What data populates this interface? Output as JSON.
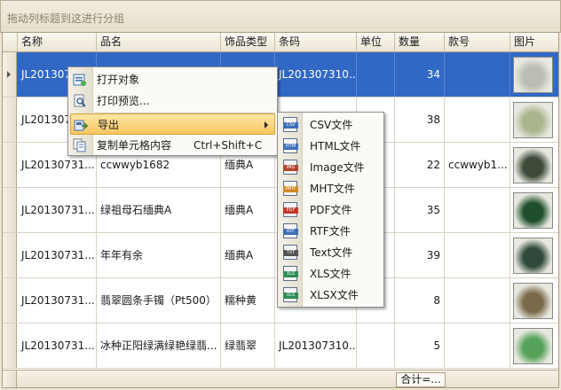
{
  "group_panel": {
    "hint": "拖动列标题到这进行分组"
  },
  "columns": [
    "名称",
    "品名",
    "饰品类型",
    "条码",
    "单位",
    "数量",
    "款号",
    "图片"
  ],
  "rows": [
    {
      "name": "JL201307",
      "product": "",
      "type": "",
      "barcode": "JL201307310...",
      "unit": "",
      "qty": "34",
      "style_no": "",
      "thumb": "#b9bdb3",
      "selected": true
    },
    {
      "name": "JL201307",
      "product": "",
      "type": "",
      "barcode": "",
      "unit": "",
      "qty": "38",
      "style_no": "",
      "thumb": "#a9b58c",
      "selected": false
    },
    {
      "name": "JL20130731...",
      "product": "ccwwyb1682",
      "type": "缅典A",
      "barcode": "",
      "unit": "",
      "qty": "22",
      "style_no": "ccwwyb1...",
      "thumb": "#3d4a3a",
      "selected": false
    },
    {
      "name": "JL20130731...",
      "product": "绿祖母石缅典A",
      "type": "缅典A",
      "barcode": "",
      "unit": "",
      "qty": "35",
      "style_no": "",
      "thumb": "#1f4f2c",
      "selected": false
    },
    {
      "name": "JL20130731...",
      "product": "年年有余",
      "type": "缅典A",
      "barcode": "",
      "unit": "",
      "qty": "39",
      "style_no": "",
      "thumb": "#2f4a3a",
      "selected": false
    },
    {
      "name": "JL20130731...",
      "product": "翡翠圆条手镯（Pt500）",
      "type": "糯种黄",
      "barcode": "",
      "unit": "",
      "qty": "8",
      "style_no": "",
      "thumb": "#7a6a4a",
      "selected": false
    },
    {
      "name": "JL20130731...",
      "product": "冰种正阳绿满绿艳绿翡...",
      "type": "绿翡翠",
      "barcode": "JL201307310...",
      "unit": "",
      "qty": "5",
      "style_no": "",
      "thumb": "#56a25a",
      "selected": false
    }
  ],
  "footer": {
    "summary": "合计=..."
  },
  "context_menu": {
    "items": [
      {
        "label": "打开对象",
        "icon": "open-object-icon",
        "shortcut": ""
      },
      {
        "label": "打印预览...",
        "icon": "print-preview-icon",
        "shortcut": ""
      },
      {
        "label": "导出",
        "icon": "export-icon",
        "shortcut": ""
      },
      {
        "label": "复制单元格内容",
        "icon": "copy-icon",
        "shortcut": "Ctrl+Shift+C"
      }
    ]
  },
  "export_menu": {
    "items": [
      {
        "label": "CSV文件",
        "tag": "CSV",
        "color": "#3f6fb5"
      },
      {
        "label": "HTML文件",
        "tag": "HTM",
        "color": "#3f6fb5"
      },
      {
        "label": "Image文件",
        "tag": "IMG",
        "color": "#b3452e"
      },
      {
        "label": "MHT文件",
        "tag": "MHT",
        "color": "#d08a2a"
      },
      {
        "label": "PDF文件",
        "tag": "PDF",
        "color": "#c0392b"
      },
      {
        "label": "RTF文件",
        "tag": "RTF",
        "color": "#3f6fb5"
      },
      {
        "label": "Text文件",
        "tag": "TXT",
        "color": "#555555"
      },
      {
        "label": "XLS文件",
        "tag": "XLS",
        "color": "#2e8b57"
      },
      {
        "label": "XLSX文件",
        "tag": "XLS",
        "color": "#2e8b57"
      }
    ]
  }
}
